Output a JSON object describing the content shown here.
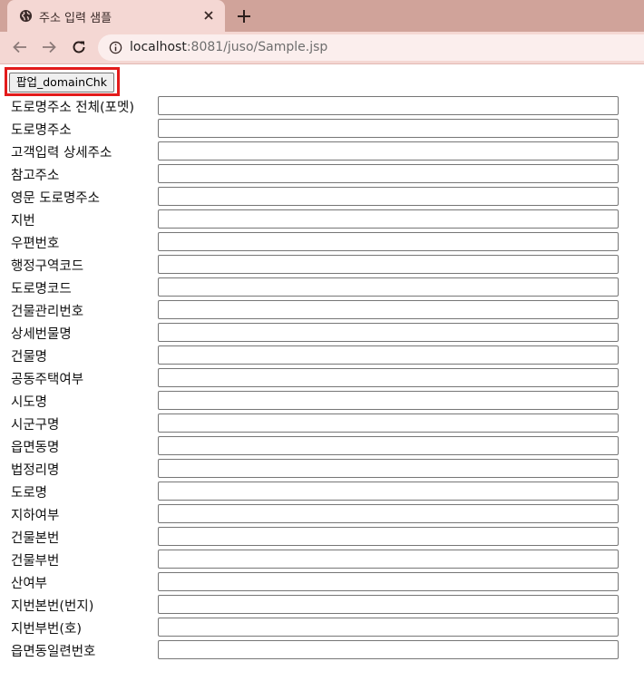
{
  "browser": {
    "tab_title": "주소 입력 샘플",
    "url_host": "localhost",
    "url_rest": ":8081/juso/Sample.jsp"
  },
  "page": {
    "popup_button_label": "팝업_domainChk",
    "fields": [
      {
        "label": "도로명주소 전체(포멧)",
        "value": ""
      },
      {
        "label": "도로명주소",
        "value": ""
      },
      {
        "label": "고객입력 상세주소",
        "value": ""
      },
      {
        "label": "참고주소",
        "value": ""
      },
      {
        "label": "영문 도로명주소",
        "value": ""
      },
      {
        "label": "지번",
        "value": ""
      },
      {
        "label": "우편번호",
        "value": ""
      },
      {
        "label": "행정구역코드",
        "value": ""
      },
      {
        "label": "도로명코드",
        "value": ""
      },
      {
        "label": "건물관리번호",
        "value": ""
      },
      {
        "label": "상세번물명",
        "value": ""
      },
      {
        "label": "건물명",
        "value": ""
      },
      {
        "label": "공동주택여부",
        "value": ""
      },
      {
        "label": "시도명",
        "value": ""
      },
      {
        "label": "시군구명",
        "value": ""
      },
      {
        "label": "읍면동명",
        "value": ""
      },
      {
        "label": "법정리명",
        "value": ""
      },
      {
        "label": "도로명",
        "value": ""
      },
      {
        "label": "지하여부",
        "value": ""
      },
      {
        "label": "건물본번",
        "value": ""
      },
      {
        "label": "건물부번",
        "value": ""
      },
      {
        "label": "산여부",
        "value": ""
      },
      {
        "label": "지번본번(번지)",
        "value": ""
      },
      {
        "label": "지번부번(호)",
        "value": ""
      },
      {
        "label": "읍면동일련번호",
        "value": ""
      }
    ]
  },
  "colors": {
    "tabstrip": "#d0a39a",
    "toolbar": "#f4d7d3",
    "highlight": "#e31b1b"
  },
  "icons": [
    "globe-icon",
    "close-icon",
    "plus-icon",
    "back-arrow-icon",
    "forward-arrow-icon",
    "reload-icon",
    "info-icon"
  ]
}
